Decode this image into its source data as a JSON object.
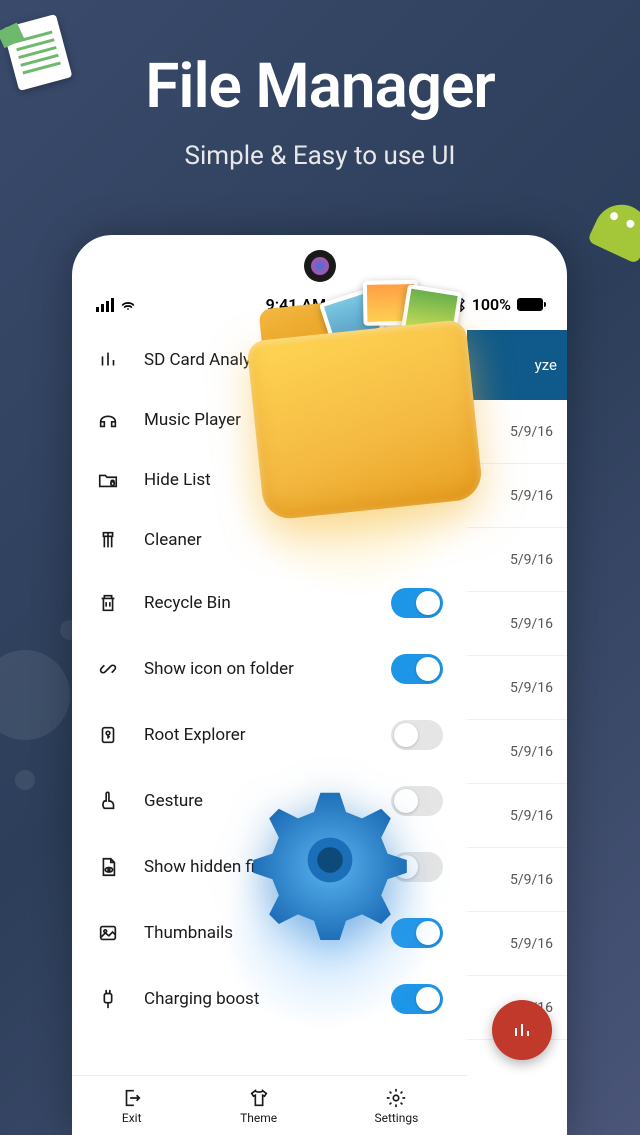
{
  "hero": {
    "title": "File Manager",
    "subtitle": "Simple & Easy to use UI"
  },
  "statusbar": {
    "time": "9:41 AM",
    "battery": "100%"
  },
  "menu": {
    "items": [
      {
        "label": "SD Card Analyst",
        "icon": "analyst",
        "toggle": null
      },
      {
        "label": "Music Player",
        "icon": "headphones",
        "toggle": null
      },
      {
        "label": "Hide List",
        "icon": "folder-lock",
        "toggle": null
      },
      {
        "label": "Cleaner",
        "icon": "broom",
        "toggle": null
      },
      {
        "label": "Recycle Bin",
        "icon": "trash",
        "toggle": true
      },
      {
        "label": "Show icon on folder",
        "icon": "link",
        "toggle": true
      },
      {
        "label": "Root Explorer",
        "icon": "key",
        "toggle": false
      },
      {
        "label": "Gesture",
        "icon": "touch",
        "toggle": false
      },
      {
        "label": "Show hidden files",
        "icon": "file-eye",
        "toggle": false
      },
      {
        "label": "Thumbnails",
        "icon": "image",
        "toggle": true
      },
      {
        "label": "Charging boost",
        "icon": "plug",
        "toggle": true
      }
    ]
  },
  "bottomnav": {
    "items": [
      {
        "label": "Exit",
        "icon": "exit"
      },
      {
        "label": "Theme",
        "icon": "shirt"
      },
      {
        "label": "Settings",
        "icon": "gear"
      }
    ]
  },
  "behind": {
    "header": "yze",
    "dates": [
      "5/9/16",
      "5/9/16",
      "5/9/16",
      "5/9/16",
      "5/9/16",
      "5/9/16",
      "5/9/16",
      "5/9/16",
      "5/9/16",
      "5/9/16"
    ]
  }
}
